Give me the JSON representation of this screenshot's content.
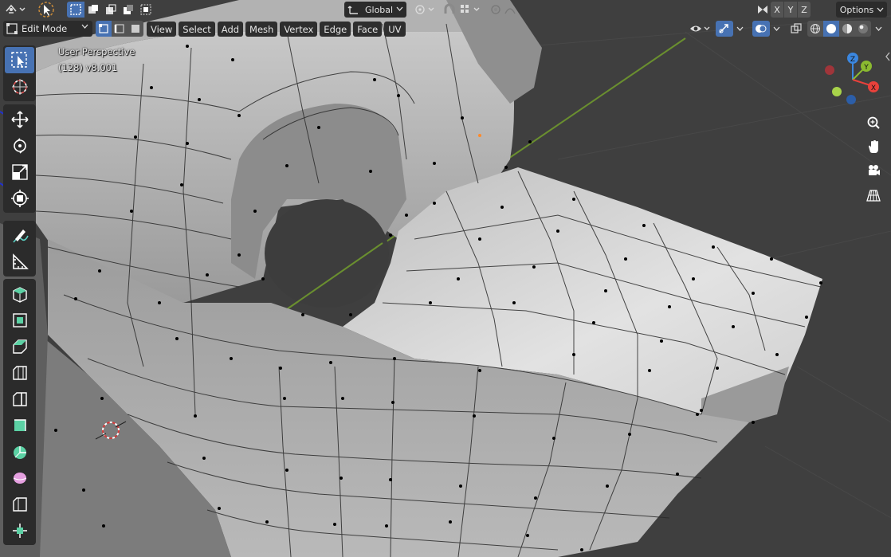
{
  "header": {
    "transform_orientation": "Global",
    "axis_labels": [
      "X",
      "Y",
      "Z"
    ],
    "options_label": "Options"
  },
  "mode": {
    "label": "Edit Mode"
  },
  "menus": [
    "View",
    "Select",
    "Add",
    "Mesh",
    "Vertex",
    "Edge",
    "Face",
    "UV"
  ],
  "viewport": {
    "view_name": "User Perspective",
    "object_info": "(128) v8.001"
  },
  "gizmo": {
    "x_label": "X",
    "y_label": "Y",
    "z_label": "Z",
    "x_color": "#e8413b",
    "y_color": "#8bba30",
    "z_color": "#3b87e0"
  },
  "tools": [
    "select-box-icon",
    "cursor-icon",
    "move-icon",
    "rotate-icon",
    "scale-icon",
    "transform-icon",
    "annotate-icon",
    "measure-icon",
    "add-cube-icon",
    "extrude-region-icon",
    "inset-faces-icon",
    "bevel-icon",
    "loop-cut-icon",
    "knife-icon",
    "poly-build-icon",
    "spin-icon",
    "smooth-icon",
    "edge-slide-icon",
    "shrink-fatten-icon"
  ],
  "colors": {
    "header_bg": "#3d3d3d",
    "accent": "#4772b3",
    "mesh_light": "#d4d4d4",
    "mesh_dark": "#6e6e6e",
    "grid_line": "#6a8f2f"
  }
}
